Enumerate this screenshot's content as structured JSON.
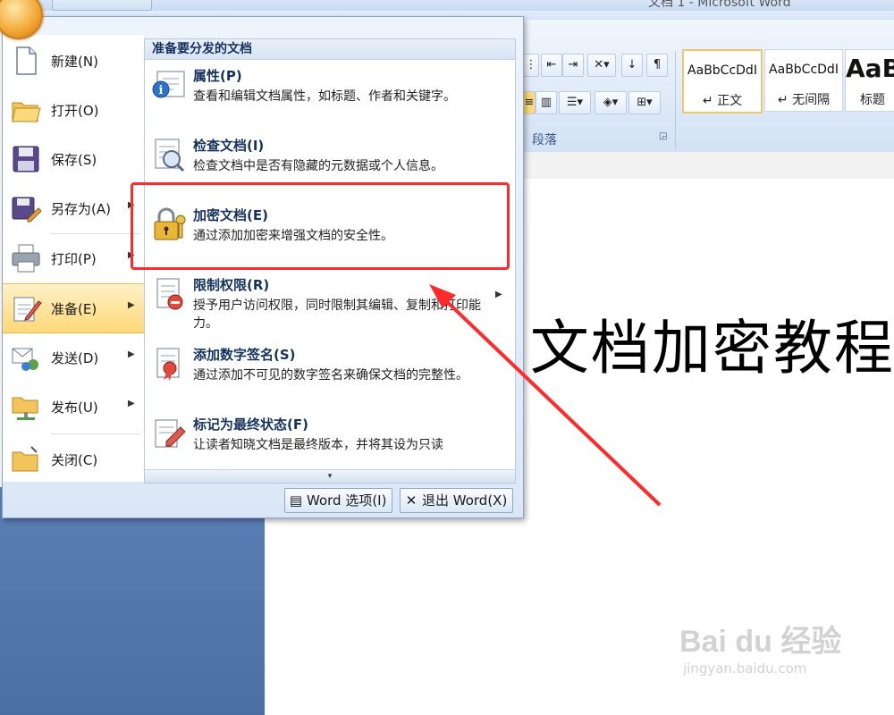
{
  "window": {
    "title": "文档 1 - Microsoft Word"
  },
  "ribbon": {
    "paragraph_group_label": "段落",
    "styles": [
      {
        "sample": "AaBbCcDdI",
        "name": "↵ 正文",
        "selected": true
      },
      {
        "sample": "AaBbCcDdI",
        "name": "↵ 无间隔",
        "selected": false
      },
      {
        "sample": "AaB",
        "name": "标题",
        "selected": false
      }
    ]
  },
  "office_menu": {
    "left_items": [
      {
        "label": "新建(N)",
        "icon": "new-document-icon",
        "has_submenu": false
      },
      {
        "label": "打开(O)",
        "icon": "open-folder-icon",
        "has_submenu": false
      },
      {
        "label": "保存(S)",
        "icon": "save-disk-icon",
        "has_submenu": false
      },
      {
        "label": "另存为(A)",
        "icon": "save-as-icon",
        "has_submenu": true
      },
      {
        "label": "打印(P)",
        "icon": "printer-icon",
        "has_submenu": true
      },
      {
        "label": "准备(E)",
        "icon": "prepare-icon",
        "has_submenu": true,
        "active": true
      },
      {
        "label": "发送(D)",
        "icon": "send-icon",
        "has_submenu": true
      },
      {
        "label": "发布(U)",
        "icon": "publish-icon",
        "has_submenu": true
      },
      {
        "label": "关闭(C)",
        "icon": "close-folder-icon",
        "has_submenu": false
      }
    ],
    "submenu": {
      "header": "准备要分发的文档",
      "items": [
        {
          "title": "属性(P)",
          "desc": "查看和编辑文档属性，如标题、作者和关键字。",
          "icon": "properties-icon"
        },
        {
          "title": "检查文档(I)",
          "desc": "检查文档中是否有隐藏的元数据或个人信息。",
          "icon": "inspect-document-icon"
        },
        {
          "title": "加密文档(E)",
          "desc": "通过添加加密来增强文档的安全性。",
          "icon": "encrypt-lock-icon"
        },
        {
          "title": "限制权限(R)",
          "desc": "授予用户访问权限，同时限制其编辑、复制和打印能力。",
          "icon": "restrict-permission-icon"
        },
        {
          "title": "添加数字签名(S)",
          "desc": "通过添加不可见的数字签名来确保文档的完整性。",
          "icon": "digital-signature-icon"
        },
        {
          "title": "标记为最终状态(F)",
          "desc": "让读者知晓文档是最终版本，并将其设为只读",
          "icon": "mark-final-icon"
        }
      ]
    },
    "footer": {
      "options_label": "Word 选项(I)",
      "exit_label": "退出 Word(X)"
    }
  },
  "document": {
    "visible_text": "d 文档加密教程"
  },
  "watermark": {
    "main": "Bai du 经验",
    "url": "jingyan.baidu.com"
  },
  "colors": {
    "highlight": "#ff2a2a",
    "menu_active": "#ffd877",
    "accent_blue": "#15325f"
  }
}
